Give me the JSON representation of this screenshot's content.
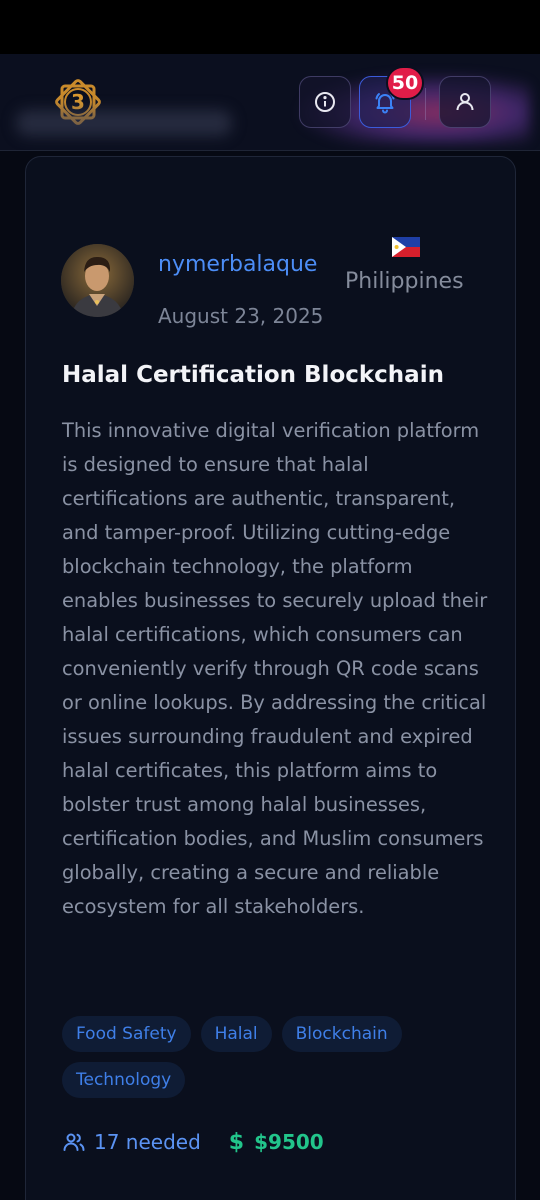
{
  "header": {
    "notification_count": "50",
    "accent_color": "#3b5bdb",
    "badge_color": "#e11d48",
    "icons": [
      "logo-icon",
      "info-icon",
      "bell-icon",
      "user-icon"
    ]
  },
  "post": {
    "username": "nymerbalaque",
    "date": "August 23, 2025",
    "country": "Philippines",
    "title": "Halal Certification Blockchain",
    "description": "This innovative digital verification platform is designed to ensure that halal certifications are authentic, transparent, and tamper-proof. Utilizing cutting-edge blockchain technology, the platform enables businesses to securely upload their halal certifications, which consumers can conveniently verify through QR code scans or online lookups. By addressing the critical issues surrounding fraudulent and expired halal certificates, this platform aims to bolster trust among halal businesses, certification bodies, and Muslim consumers globally, creating a secure and reliable ecosystem for all stakeholders.",
    "tags": [
      "Food Safety",
      "Halal",
      "Blockchain",
      "Technology"
    ],
    "needed": "17 needed",
    "budget": "$9500",
    "budget_symbol": "$",
    "colors": {
      "username": "#4c8df6",
      "tag_text": "#3f7fe8",
      "budget": "#22c58b"
    }
  }
}
